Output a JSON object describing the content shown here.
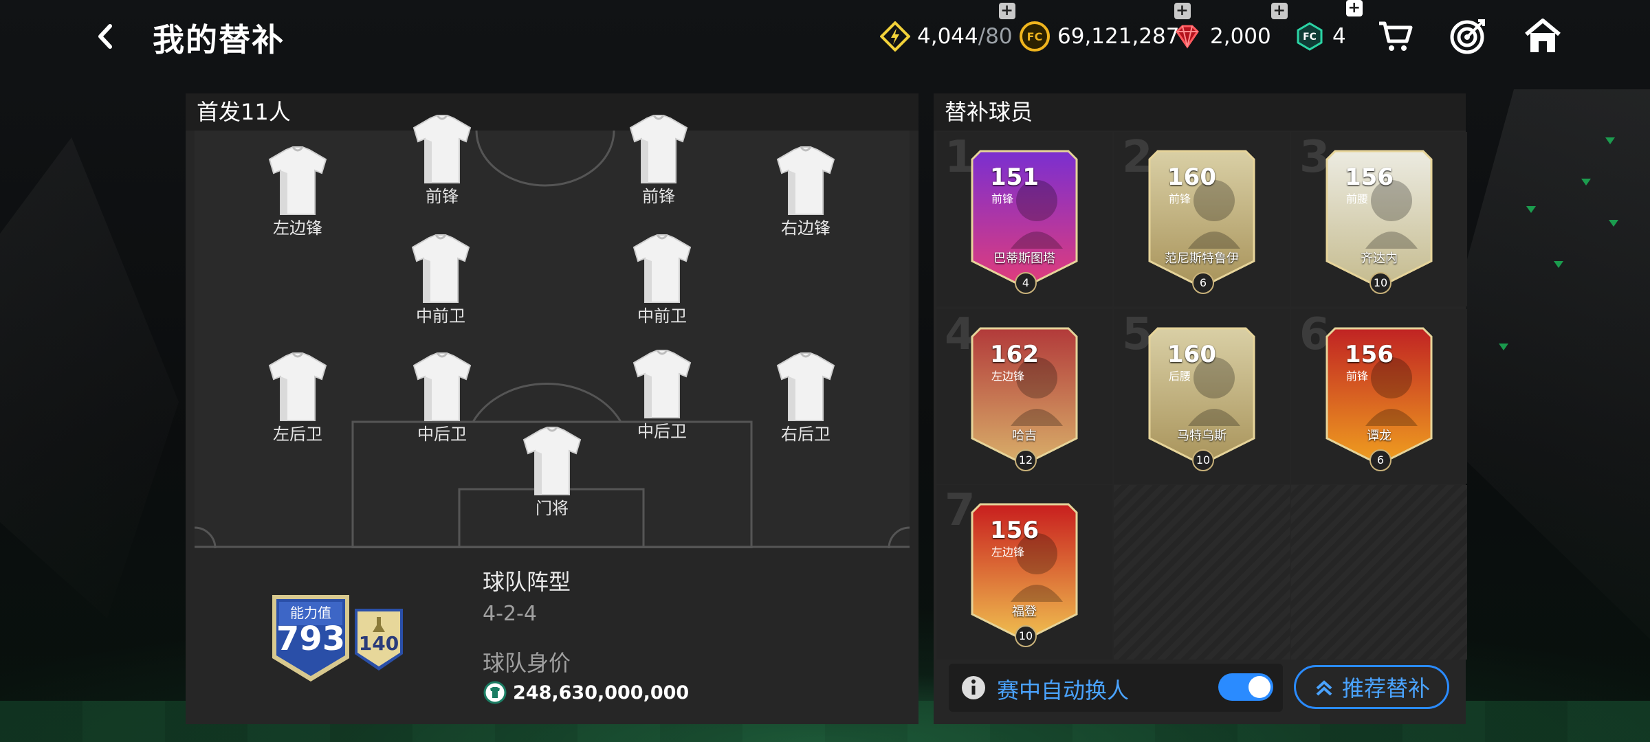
{
  "header": {
    "title": "我的替补",
    "resources": [
      {
        "icon": "lightning-icon",
        "value": "4,044",
        "max": "/80"
      },
      {
        "icon": "coin-icon",
        "value": "69,121,287"
      },
      {
        "icon": "gem-icon",
        "value": "2,000"
      },
      {
        "icon": "token-icon",
        "value": "4"
      }
    ],
    "icons": [
      "cart-icon",
      "target-icon",
      "home-icon"
    ]
  },
  "starting": {
    "heading": "首发11人",
    "players": [
      {
        "label": "左边锋"
      },
      {
        "label": "前锋"
      },
      {
        "label": "前锋"
      },
      {
        "label": "右边锋"
      },
      {
        "label": "中前卫"
      },
      {
        "label": "中前卫"
      },
      {
        "label": "左后卫"
      },
      {
        "label": "中后卫"
      },
      {
        "label": "中后卫"
      },
      {
        "label": "右后卫"
      },
      {
        "label": "门将"
      }
    ],
    "ability_label": "能力值",
    "ability_value": "793",
    "ability_bonus": "140",
    "formation_title": "球队阵型",
    "formation_value": "4-2-4",
    "value_title": "球队身价",
    "team_value": "248,630,000,000"
  },
  "bench": {
    "heading": "替补球员",
    "slots": [
      {
        "num": "1",
        "ovr": "151",
        "pos": "前锋",
        "name": "巴蒂斯图塔",
        "level": "4"
      },
      {
        "num": "2",
        "ovr": "160",
        "pos": "前锋",
        "name": "范尼斯特鲁伊",
        "level": "6"
      },
      {
        "num": "3",
        "ovr": "156",
        "pos": "前腰",
        "name": "齐达内",
        "level": "10"
      },
      {
        "num": "4",
        "ovr": "162",
        "pos": "左边锋",
        "name": "哈吉",
        "level": "12"
      },
      {
        "num": "5",
        "ovr": "160",
        "pos": "后腰",
        "name": "马特乌斯",
        "level": "10"
      },
      {
        "num": "6",
        "ovr": "156",
        "pos": "前锋",
        "name": "谭龙",
        "level": "6"
      },
      {
        "num": "7",
        "ovr": "156",
        "pos": "左边锋",
        "name": "福登",
        "level": "10"
      }
    ],
    "auto_sub_label": "赛中自动换人",
    "auto_sub_on": true,
    "recommend_label": "推荐替补"
  },
  "colors": {
    "accent": "#2a8bff",
    "panel": "#262626",
    "gold": "#c9b27a"
  }
}
